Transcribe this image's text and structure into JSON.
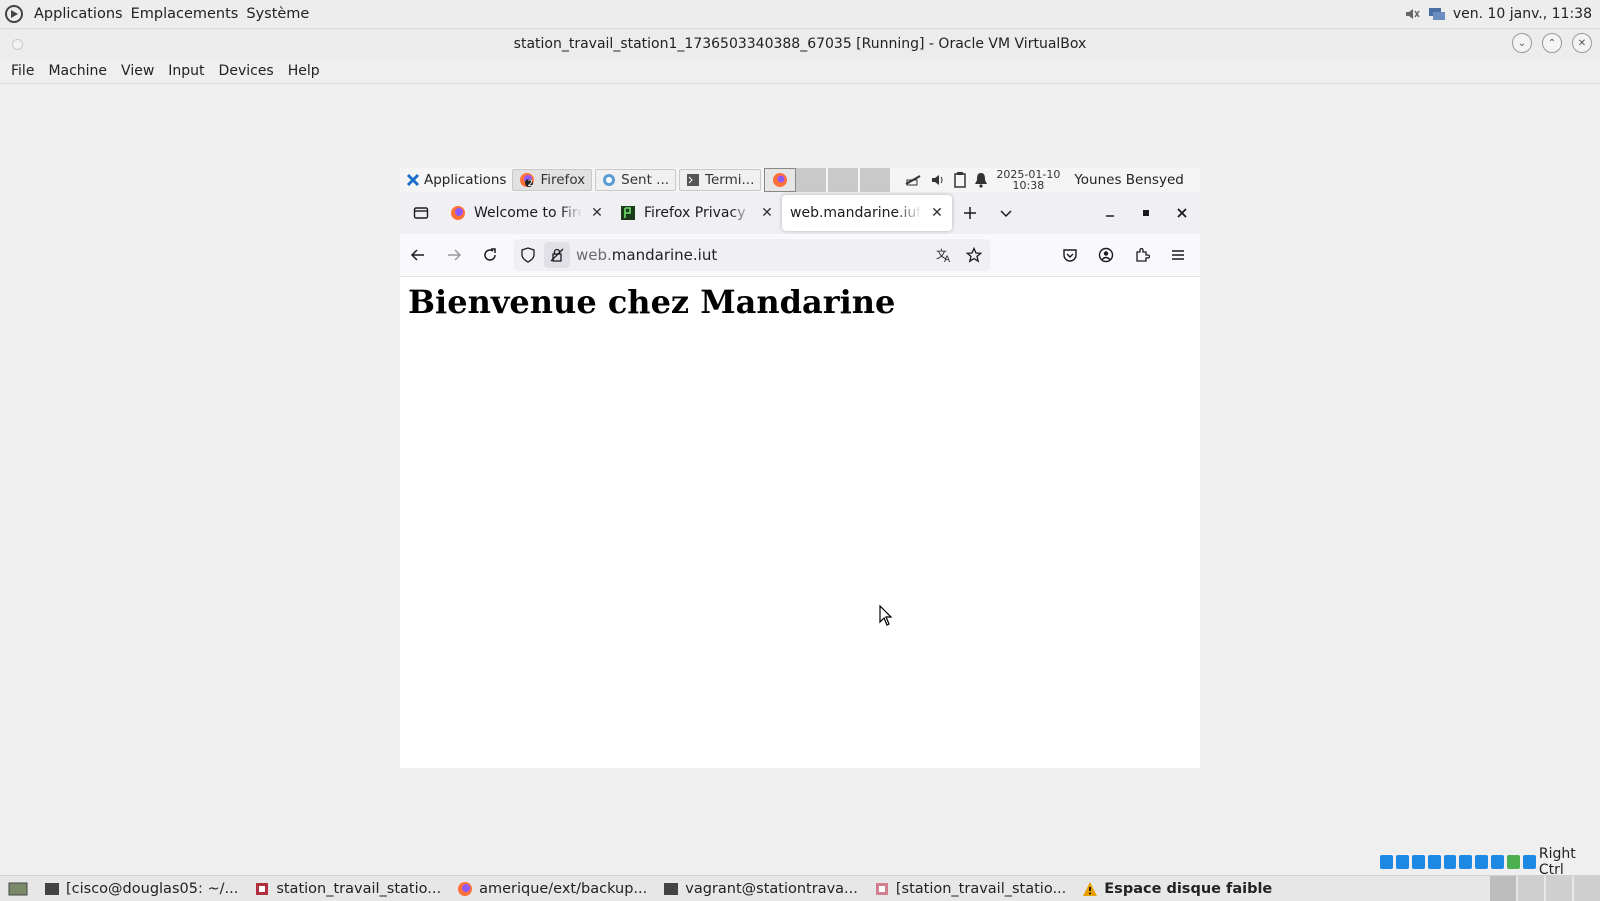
{
  "host": {
    "menus": [
      "Applications",
      "Emplacements",
      "Système"
    ],
    "clock": "ven. 10 janv., 11:38",
    "window_title": "station_travail_station1_1736503340388_67035 [Running] - Oracle VM VirtualBox",
    "vbox_menus": [
      "File",
      "Machine",
      "View",
      "Input",
      "Devices",
      "Help"
    ],
    "right_ctrl": "Right Ctrl",
    "tasks": [
      "[cisco@douglas05: ~/...",
      "station_travail_statio...",
      "amerique/ext/backup...",
      "vagrant@stationtrava...",
      "[station_travail_statio...",
      "Espace disque faible"
    ]
  },
  "vm": {
    "panel": {
      "applications": "Applications",
      "firefox_badge": "2",
      "tasks": [
        "Firefox",
        "Sent ...",
        "Termi..."
      ],
      "clock_date": "2025-01-10",
      "clock_time": "10:38",
      "user": "Younes Bensyed"
    },
    "tabs": [
      {
        "label": "Welcome to Firefox"
      },
      {
        "label": "Firefox Privacy Notice"
      },
      {
        "label": "web.mandarine.iut/"
      }
    ],
    "url": {
      "dim": "web.",
      "host": "mandarine.iut"
    },
    "page_heading": "Bienvenue chez Mandarine"
  },
  "colors": {
    "firefox_orange": "#ff7139",
    "warning": "#e8a000",
    "accent_blue": "#1e88e5"
  }
}
